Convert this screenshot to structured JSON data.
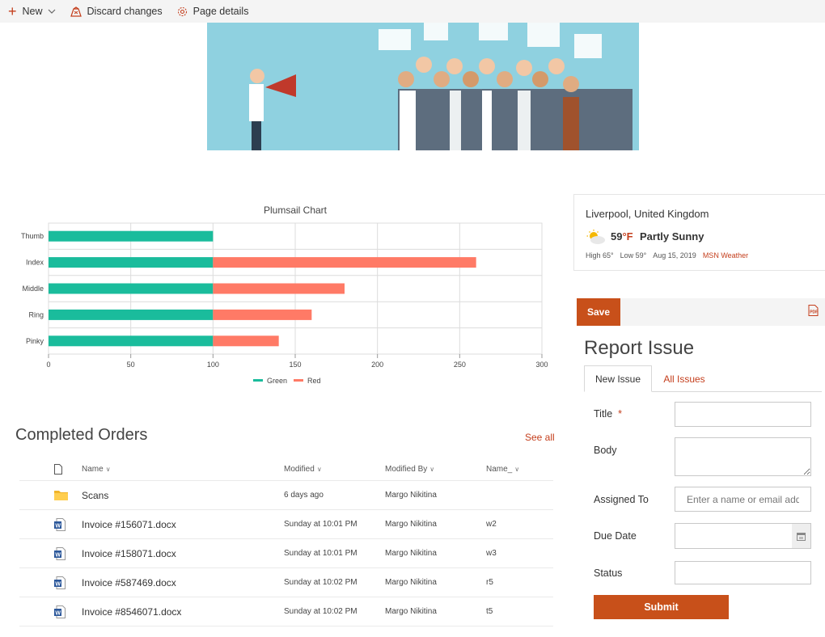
{
  "command_bar": {
    "new_label": "New",
    "discard_label": "Discard changes",
    "page_details_label": "Page details"
  },
  "chart_data": {
    "type": "bar",
    "orientation": "horizontal",
    "stacked": true,
    "title": "Plumsail Chart",
    "categories": [
      "Thumb",
      "Index",
      "Middle",
      "Ring",
      "Pinky"
    ],
    "series": [
      {
        "name": "Green",
        "color": "#1abc9c",
        "values": [
          100,
          100,
          100,
          100,
          100
        ]
      },
      {
        "name": "Red",
        "color": "#ff7a66",
        "values": [
          0,
          160,
          80,
          60,
          40
        ]
      }
    ],
    "xlim": [
      0,
      300
    ],
    "xticks": [
      "0",
      "50",
      "100",
      "150",
      "200",
      "250",
      "300"
    ],
    "grid": true,
    "legend_position": "bottom"
  },
  "orders": {
    "title": "Completed Orders",
    "see_all": "See all",
    "columns": {
      "name": "Name",
      "modified": "Modified",
      "modified_by": "Modified By",
      "name2": "Name_"
    },
    "rows": [
      {
        "icon": "folder-icon",
        "name": "Scans",
        "modified": "6 days ago",
        "modified_by": "Margo Nikitina",
        "name2": ""
      },
      {
        "icon": "word-doc-icon",
        "name": "Invoice #156071.docx",
        "modified": "Sunday at 10:01 PM",
        "modified_by": "Margo Nikitina",
        "name2": "w2"
      },
      {
        "icon": "word-doc-icon",
        "name": "Invoice #158071.docx",
        "modified": "Sunday at 10:01 PM",
        "modified_by": "Margo Nikitina",
        "name2": "w3"
      },
      {
        "icon": "word-doc-icon",
        "name": "Invoice #587469.docx",
        "modified": "Sunday at 10:02 PM",
        "modified_by": "Margo Nikitina",
        "name2": "r5"
      },
      {
        "icon": "word-doc-icon",
        "name": "Invoice #8546071.docx",
        "modified": "Sunday at 10:02 PM",
        "modified_by": "Margo Nikitina",
        "name2": "t5"
      }
    ]
  },
  "weather": {
    "location": "Liverpool, United Kingdom",
    "temp": "59",
    "unit": "°F",
    "condition": "Partly Sunny",
    "high": "High 65°",
    "low": "Low 59°",
    "date": "Aug 15, 2019",
    "source": "MSN Weather"
  },
  "form": {
    "save_label": "Save",
    "title": "Report Issue",
    "tabs": [
      "New Issue",
      "All Issues"
    ],
    "fields": {
      "title_label": "Title",
      "required_mark": "*",
      "body_label": "Body",
      "assigned_label": "Assigned To",
      "assigned_placeholder": "Enter a name or email address",
      "due_label": "Due Date",
      "status_label": "Status"
    },
    "submit_label": "Submit"
  },
  "colors": {
    "accent": "#c8501a",
    "green": "#1abc9c",
    "red": "#ff7a66"
  }
}
